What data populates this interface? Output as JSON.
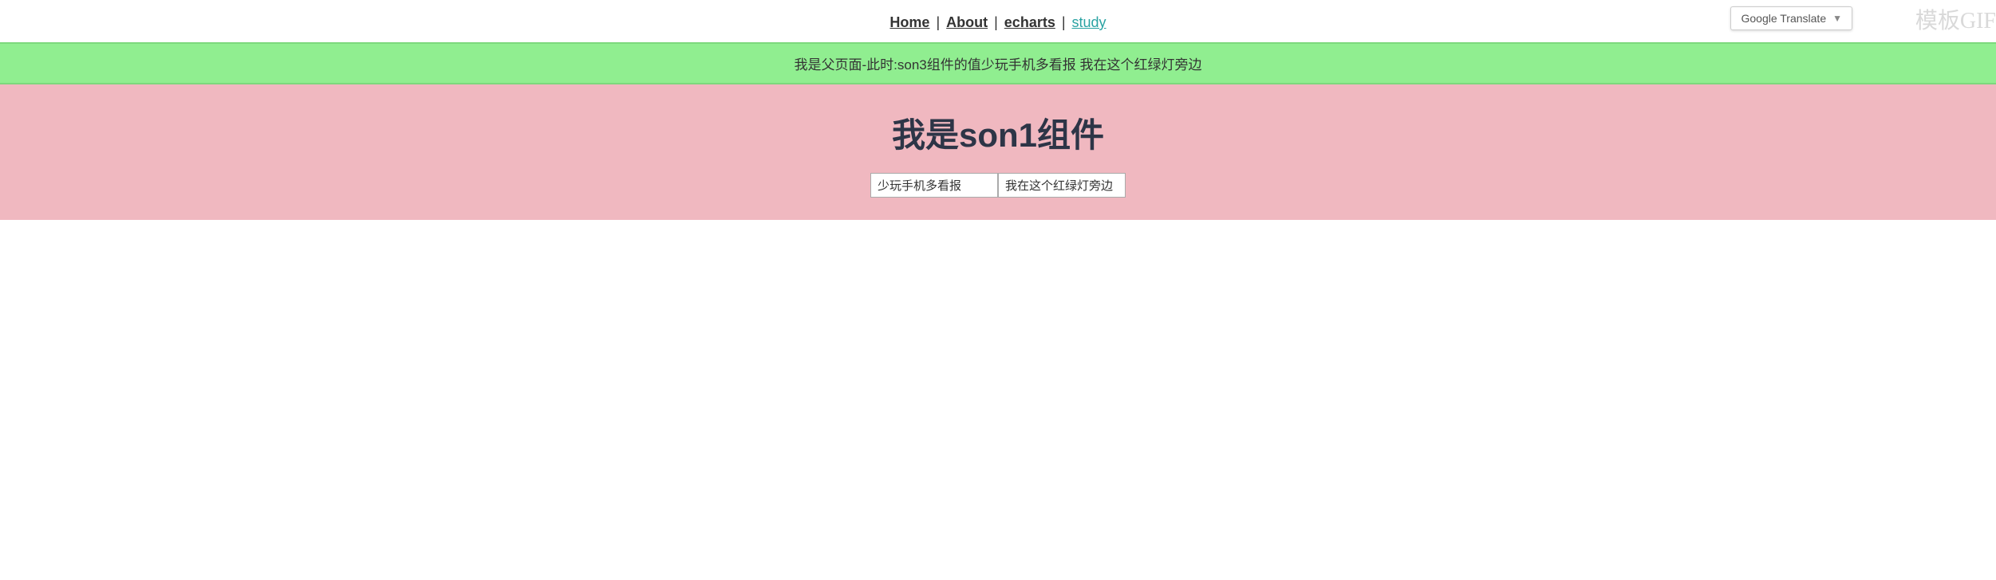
{
  "nav": {
    "home_label": "Home",
    "about_label": "About",
    "echarts_label": "echarts",
    "study_label": "study",
    "separator": "|"
  },
  "green_banner": {
    "text": "我是父页面-此时:son3组件的值少玩手机多看报 我在这个红绿灯旁边"
  },
  "son1": {
    "title": "我是son1组件",
    "input1_value": "少玩手机多看报",
    "input2_value": "我在这个红绿灯旁边"
  },
  "google_translate": {
    "label": "Google Translate"
  },
  "watermark": {
    "text": "模板GIF"
  }
}
